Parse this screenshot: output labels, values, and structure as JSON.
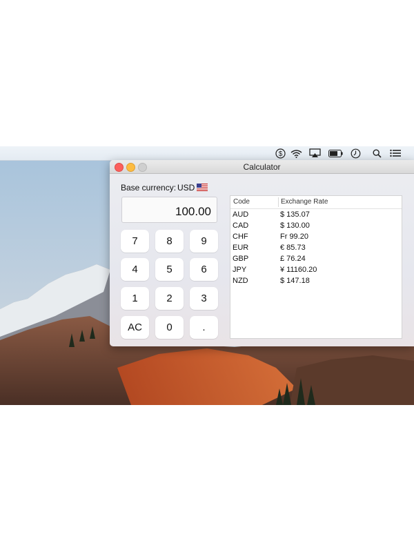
{
  "menubar": {
    "icons": [
      "dollar-icon",
      "wifi-icon",
      "airplay-icon",
      "battery-icon",
      "clock-icon",
      "search-icon",
      "list-icon"
    ]
  },
  "window": {
    "title": "Calculator",
    "base_currency_label": "Base currency:",
    "base_currency_code": "USD",
    "display_value": "100.00"
  },
  "keypad": {
    "keys": [
      "7",
      "8",
      "9",
      "4",
      "5",
      "6",
      "1",
      "2",
      "3",
      "AC",
      "0",
      "."
    ]
  },
  "rates_table": {
    "columns": [
      "Code",
      "Exchange Rate"
    ],
    "rows": [
      {
        "code": "AUD",
        "rate": "$ 135.07"
      },
      {
        "code": "CAD",
        "rate": "$ 130.00"
      },
      {
        "code": "CHF",
        "rate": "Fr 99.20"
      },
      {
        "code": "EUR",
        "rate": "€ 85.73"
      },
      {
        "code": "GBP",
        "rate": "£ 76.24"
      },
      {
        "code": "JPY",
        "rate": "¥ 11160.20"
      },
      {
        "code": "NZD",
        "rate": "$ 147.18"
      }
    ]
  },
  "colors": {
    "close": "#fc605c",
    "minimize": "#fdbc40",
    "zoom_disabled": "#cfcfcf"
  }
}
